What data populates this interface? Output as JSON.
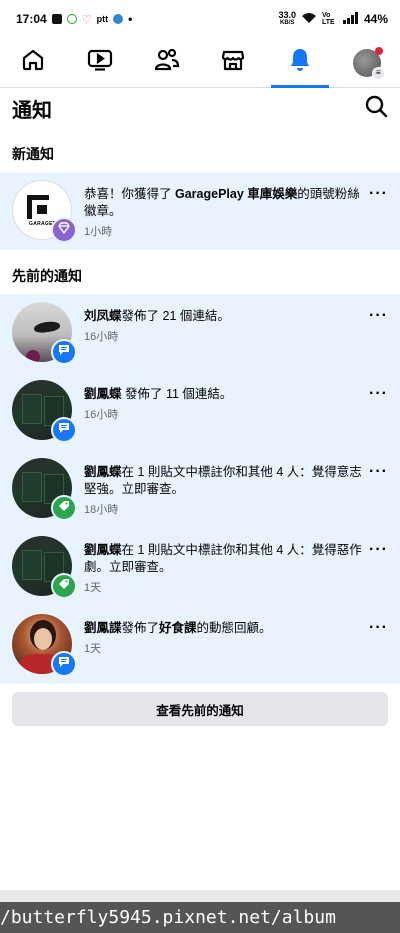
{
  "status": {
    "time": "17:04",
    "speed": "33.0",
    "speed_unit": "KB/S",
    "network": "Vo LTE",
    "battery": "44%"
  },
  "nav": {
    "tabs": [
      {
        "icon": "home-icon"
      },
      {
        "icon": "video-icon"
      },
      {
        "icon": "friends-icon"
      },
      {
        "icon": "marketplace-icon"
      },
      {
        "icon": "bell-icon",
        "active": true
      },
      {
        "icon": "profile-avatar"
      }
    ]
  },
  "header": {
    "title": "通知",
    "search_icon": "search-icon"
  },
  "sections": {
    "new_title": "新通知",
    "earlier_title": "先前的通知"
  },
  "notifications": [
    {
      "actor": "",
      "pre": "恭喜！你獲得了 ",
      "bold": "GaragePlay 車庫娛樂",
      "post": "的頭號粉絲徽章。",
      "time": "1小時",
      "badge_color": "#8a63d2",
      "badge_icon": "diamond-icon",
      "avatar_text": "GARAGEPL"
    },
    {
      "actor": "刘凤蝶",
      "pre": "發佈了 21 個連結。",
      "bold": "",
      "post": "",
      "time": "16小時",
      "badge_color": "#1877f2",
      "badge_icon": "comment-icon"
    },
    {
      "actor": "劉鳳蝶",
      "pre": " 發佈了 11 個連結。",
      "bold": "",
      "post": "",
      "time": "16小時",
      "badge_color": "#1877f2",
      "badge_icon": "comment-icon"
    },
    {
      "actor": "劉鳳蝶",
      "pre": "在 1 則貼文中標註你和其他 4 人：覺得意志堅強。立即審查。",
      "bold": "",
      "post": "",
      "time": "18小時",
      "badge_color": "#2da44e",
      "badge_icon": "tag-icon"
    },
    {
      "actor": "劉鳳蝶",
      "pre": "在 1 則貼文中標註你和其他 4 人：覺得惡作劇。立即審查。",
      "bold": "",
      "post": "",
      "time": "1天",
      "badge_color": "#2da44e",
      "badge_icon": "tag-icon"
    },
    {
      "actor": "劉鳳諜",
      "pre": "發佈了",
      "bold": "好食課",
      "post": "的動態回顧。",
      "time": "1天",
      "badge_color": "#1877f2",
      "badge_icon": "comment-icon"
    }
  ],
  "see_previous": "查看先前的通知",
  "watermark": "/butterfly5945.pixnet.net/album",
  "colors": {
    "accent": "#1877f2",
    "unread_bg": "#e7f3ff"
  }
}
